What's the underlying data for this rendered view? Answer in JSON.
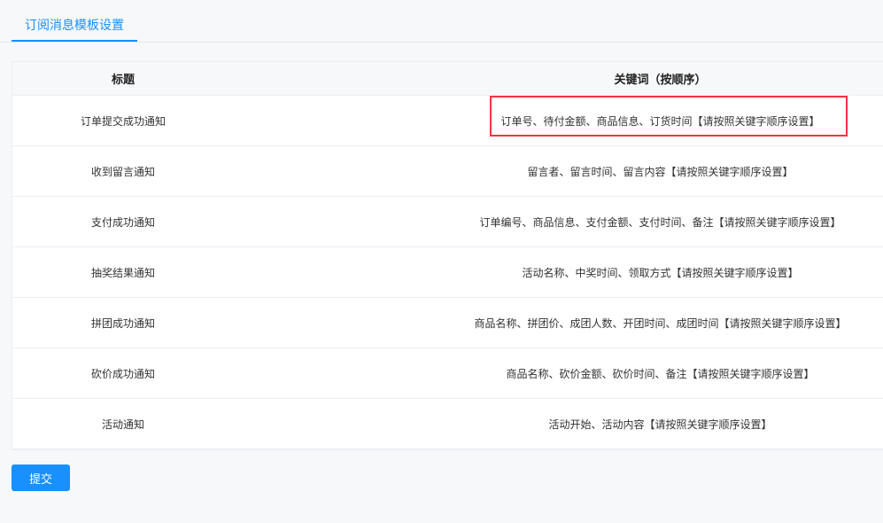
{
  "tabs": [
    {
      "label": "订阅消息模板设置",
      "active": true
    }
  ],
  "table": {
    "headers": [
      "标题",
      "关键词（按顺序）"
    ],
    "rows": [
      {
        "title": "订单提交成功通知",
        "keywords": "订单号、待付金额、商品信息、订货时间【请按照关键字顺序设置】",
        "highlighted": true
      },
      {
        "title": "收到留言通知",
        "keywords": "留言者、留言时间、留言内容【请按照关键字顺序设置】"
      },
      {
        "title": "支付成功通知",
        "keywords": "订单编号、商品信息、支付金额、支付时间、备注【请按照关键字顺序设置】"
      },
      {
        "title": "抽奖结果通知",
        "keywords": "活动名称、中奖时间、领取方式【请按照关键字顺序设置】"
      },
      {
        "title": "拼团成功通知",
        "keywords": "商品名称、拼团价、成团人数、开团时间、成团时间【请按照关键字顺序设置】"
      },
      {
        "title": "砍价成功通知",
        "keywords": "商品名称、砍价金额、砍价时间、备注【请按照关键字顺序设置】"
      },
      {
        "title": "活动通知",
        "keywords": "活动开始、活动内容【请按照关键字顺序设置】"
      }
    ]
  },
  "submit_label": "提交",
  "colors": {
    "accent": "#1890ff",
    "highlight": "#f5333f"
  }
}
